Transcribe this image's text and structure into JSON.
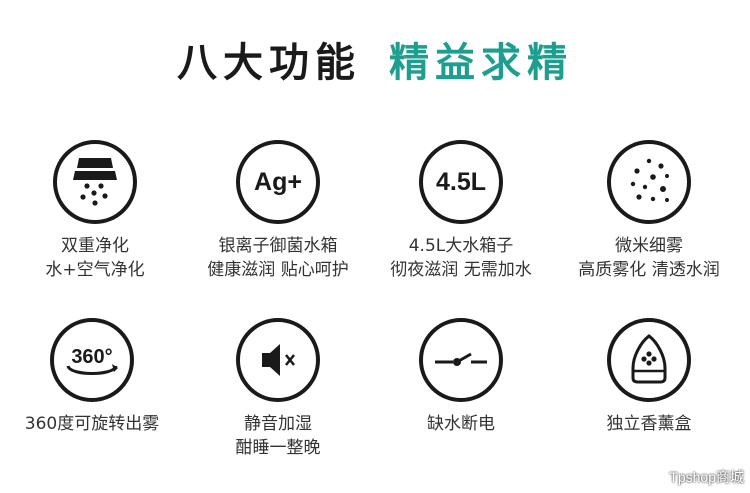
{
  "title": {
    "part1": "八大功能",
    "part2": "精益求精"
  },
  "features": [
    {
      "icon": "dual-filter-icon",
      "lines": [
        "双重净化",
        "水+空气净化"
      ]
    },
    {
      "icon_text": "Ag+",
      "lines": [
        "银离子御菌水箱",
        "健康滋润 贴心呵护"
      ]
    },
    {
      "icon_text": "4.5L",
      "lines": [
        "4.5L大水箱子",
        "彻夜滋润 无需加水"
      ]
    },
    {
      "icon": "micro-mist-icon",
      "lines": [
        "微米细雾",
        "高质雾化 清透水润"
      ]
    },
    {
      "icon_text": "360°",
      "lines": [
        "360度可旋转出雾"
      ]
    },
    {
      "icon": "mute-speaker-icon",
      "lines": [
        "静音加湿",
        "酣睡一整晚"
      ]
    },
    {
      "icon": "water-cutoff-switch-icon",
      "lines": [
        "缺水断电"
      ]
    },
    {
      "icon": "aroma-box-icon",
      "lines": [
        "独立香薰盒"
      ]
    }
  ],
  "watermark": "Tpshop商城"
}
